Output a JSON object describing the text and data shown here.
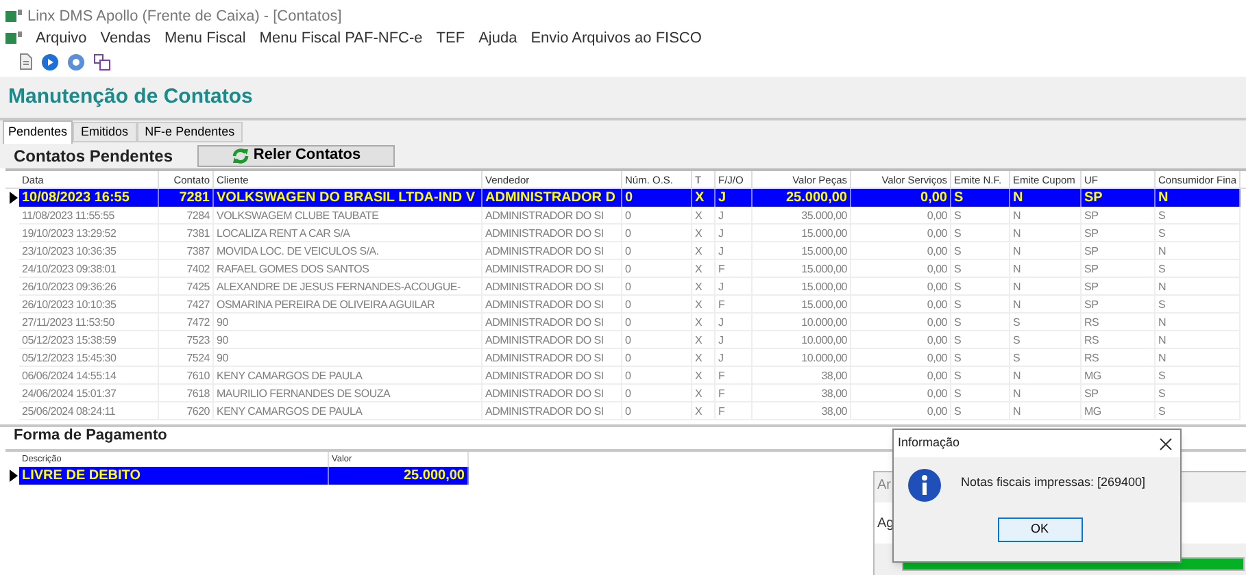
{
  "window": {
    "title": "Linx DMS Apollo (Frente de Caixa) - [Contatos]"
  },
  "menu": [
    "Arquivo",
    "Vendas",
    "Menu Fiscal",
    "Menu Fiscal PAF-NFC-e",
    "TEF",
    "Ajuda",
    "Envio Arquivos ao FISCO"
  ],
  "heading": "Manutenção de Contatos",
  "tabs": [
    {
      "label": "Pendentes",
      "selected": true
    },
    {
      "label": "Emitidos",
      "selected": false
    },
    {
      "label": "NF-e Pendentes",
      "selected": false
    }
  ],
  "section_title": "Contatos Pendentes",
  "reload_button": "Reler Contatos",
  "table": {
    "columns": [
      "Data",
      "Contato",
      "Cliente",
      "Vendedor",
      "Núm. O.S.",
      "T",
      "F/J/O",
      "Valor Peças",
      "Valor Serviços",
      "Emite N.F.",
      "Emite Cupom",
      "UF",
      "Consumidor Fina"
    ],
    "rows": [
      {
        "selected": true,
        "cells": [
          "10/08/2023 16:55",
          "7281",
          "VOLKSWAGEN DO BRASIL LTDA-IND V",
          "ADMINISTRADOR D",
          "0",
          "X",
          "J",
          "25.000,00",
          "0,00",
          "S",
          "N",
          "SP",
          "N"
        ]
      },
      {
        "selected": false,
        "cells": [
          "11/08/2023 11:55:55",
          "7284",
          "VOLKSWAGEM CLUBE TAUBATE",
          "ADMINISTRADOR DO SI",
          "0",
          "X",
          "J",
          "35.000,00",
          "0,00",
          "S",
          "N",
          "SP",
          "S"
        ]
      },
      {
        "selected": false,
        "cells": [
          "19/10/2023 13:29:52",
          "7381",
          "LOCALIZA RENT A CAR S/A",
          "ADMINISTRADOR DO SI",
          "0",
          "X",
          "J",
          "15.000,00",
          "0,00",
          "S",
          "N",
          "SP",
          "S"
        ]
      },
      {
        "selected": false,
        "cells": [
          "23/10/2023 10:36:35",
          "7387",
          "MOVIDA LOC. DE VEICULOS S/A.",
          "ADMINISTRADOR DO SI",
          "0",
          "X",
          "J",
          "15.000,00",
          "0,00",
          "S",
          "N",
          "SP",
          "N"
        ]
      },
      {
        "selected": false,
        "cells": [
          "24/10/2023 09:38:01",
          "7402",
          "RAFAEL GOMES DOS SANTOS",
          "ADMINISTRADOR DO SI",
          "0",
          "X",
          "F",
          "15.000,00",
          "0,00",
          "S",
          "N",
          "SP",
          "S"
        ]
      },
      {
        "selected": false,
        "cells": [
          "26/10/2023 09:36:26",
          "7425",
          "ALEXANDRE DE JESUS FERNANDES-ACOUGUE-",
          "ADMINISTRADOR DO SI",
          "0",
          "X",
          "J",
          "15.000,00",
          "0,00",
          "S",
          "N",
          "SP",
          "N"
        ]
      },
      {
        "selected": false,
        "cells": [
          "26/10/2023 10:10:35",
          "7427",
          "OSMARINA PEREIRA DE OLIVEIRA AGUILAR",
          "ADMINISTRADOR DO SI",
          "0",
          "X",
          "F",
          "15.000,00",
          "0,00",
          "S",
          "N",
          "SP",
          "S"
        ]
      },
      {
        "selected": false,
        "cells": [
          "27/11/2023 11:53:50",
          "7472",
          "90",
          "ADMINISTRADOR DO SI",
          "0",
          "X",
          "J",
          "10.000,00",
          "0,00",
          "S",
          "S",
          "RS",
          "N"
        ]
      },
      {
        "selected": false,
        "cells": [
          "05/12/2023 15:38:59",
          "7523",
          "90",
          "ADMINISTRADOR DO SI",
          "0",
          "X",
          "J",
          "10.000,00",
          "0,00",
          "S",
          "S",
          "RS",
          "N"
        ]
      },
      {
        "selected": false,
        "cells": [
          "05/12/2023 15:45:30",
          "7524",
          "90",
          "ADMINISTRADOR DO SI",
          "0",
          "X",
          "J",
          "10.000,00",
          "0,00",
          "S",
          "S",
          "RS",
          "N"
        ]
      },
      {
        "selected": false,
        "cells": [
          "06/06/2024 14:55:14",
          "7610",
          "KENY CAMARGOS DE PAULA",
          "ADMINISTRADOR DO SI",
          "0",
          "X",
          "F",
          "38,00",
          "0,00",
          "S",
          "N",
          "MG",
          "S"
        ]
      },
      {
        "selected": false,
        "cells": [
          "24/06/2024 15:01:37",
          "7618",
          "MAURILIO FERNANDES DE SOUZA",
          "ADMINISTRADOR DO SI",
          "0",
          "X",
          "F",
          "38,00",
          "0,00",
          "S",
          "N",
          "SP",
          "S"
        ]
      },
      {
        "selected": false,
        "cells": [
          "25/06/2024 08:24:11",
          "7620",
          "KENY CAMARGOS DE PAULA",
          "ADMINISTRADOR DO SI",
          "0",
          "X",
          "F",
          "38,00",
          "0,00",
          "S",
          "N",
          "MG",
          "S"
        ]
      }
    ]
  },
  "payment": {
    "title": "Forma de Pagamento",
    "columns": [
      "Descrição",
      "Valor"
    ],
    "rows": [
      {
        "selected": true,
        "cells": [
          "LIVRE DE DEBITO",
          "25.000,00"
        ]
      }
    ]
  },
  "background_window": {
    "title": "Ar",
    "label": "Ag",
    "progress": {
      "level": 1
    }
  },
  "dialog": {
    "title": "Informação",
    "message": "Notas fiscais impressas: [269400]",
    "button": "OK"
  }
}
